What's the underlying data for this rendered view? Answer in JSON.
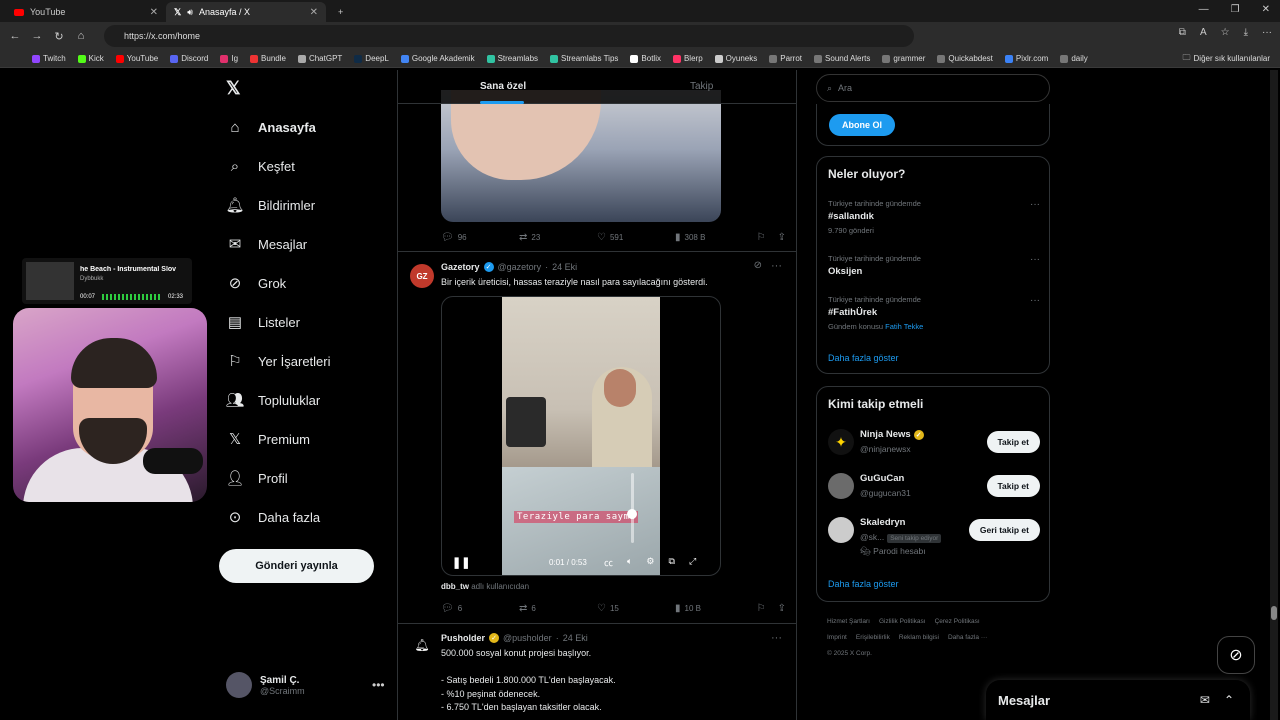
{
  "browser": {
    "tabs": [
      {
        "label": "YouTube"
      },
      {
        "label": "Anasayfa / X"
      }
    ],
    "url": "https://x.com/home",
    "bookmarks": [
      "Twitch",
      "Kick",
      "YouTube",
      "Discord",
      "Ig",
      "Bundle",
      "ChatGPT",
      "DeepL",
      "Google Akademik",
      "Streamlabs",
      "Streamlabs Tips",
      "Botlix",
      "Blerp",
      "Oyuneks",
      "Parrot",
      "Sound Alerts",
      "grammer",
      "Quickabdest",
      "Pixlr.com",
      "daily"
    ],
    "other_bookmarks": "Diğer sık kullanılanlar"
  },
  "nav": {
    "items": [
      {
        "label": "Anasayfa",
        "icon": "home-icon"
      },
      {
        "label": "Keşfet",
        "icon": "search-icon"
      },
      {
        "label": "Bildirimler",
        "icon": "bell-icon"
      },
      {
        "label": "Mesajlar",
        "icon": "mail-icon"
      },
      {
        "label": "Grok",
        "icon": "grok-icon"
      },
      {
        "label": "Listeler",
        "icon": "list-icon"
      },
      {
        "label": "Yer İşaretleri",
        "icon": "bookmark-icon"
      },
      {
        "label": "Topluluklar",
        "icon": "communities-icon"
      },
      {
        "label": "Premium",
        "icon": "x-icon"
      },
      {
        "label": "Profil",
        "icon": "profile-icon"
      },
      {
        "label": "Daha fazla",
        "icon": "more-circle-icon"
      }
    ],
    "post_button": "Gönderi yayınla",
    "profile_name": "Şamil Ç.",
    "profile_handle": "@Scraimm"
  },
  "music_overlay": {
    "title": "he Beach - Instrumental Slov",
    "artist": "Dybbukk",
    "elapsed": "00:07",
    "total": "02:33"
  },
  "feed": {
    "tab_foryou": "Sana özel",
    "tab_following": "Takip",
    "tweet1_stats": {
      "replies": "96",
      "retweets": "23",
      "likes": "591",
      "views": "308 B"
    },
    "tweet2": {
      "name": "Gazetory",
      "handle": "@gazetory",
      "date": "24 Eki",
      "text": "Bir içerik üreticisi, hassas teraziyle nasıl para sayılacağını gösterdi.",
      "video_caption": "Teraziyle para sayma",
      "video_time": "0:01 / 0:53",
      "video_progress": 0.02,
      "volume_level": 0.5,
      "credit_user": "dbb_tw",
      "credit_suffix": "adlı kullanıcıdan",
      "replies": "6",
      "retweets": "6",
      "likes": "15",
      "views": "10 B"
    },
    "tweet3": {
      "name": "Pusholder",
      "handle": "@pusholder",
      "date": "24 Eki",
      "line1": "500.000 sosyal konut projesi başlıyor.",
      "line2": "- Satış bedeli 1.800.000 TL'den başlayacak.",
      "line3": "- %10 peşinat ödenecek.",
      "line4": "- 6.750 TL'den başlayan taksitler olacak."
    }
  },
  "right": {
    "search_placeholder": "Ara",
    "subscribe": "Abone Ol",
    "trends_title": "Neler oluyor?",
    "trends": [
      {
        "context": "Türkiye tarihinde gündemde",
        "tag": "#sallandık",
        "count": "9.790 gönderi"
      },
      {
        "context": "Türkiye tarihinde gündemde",
        "tag": "Oksijen",
        "count": ""
      },
      {
        "context": "Türkiye tarihinde gündemde",
        "tag": "#FatihÜrek",
        "count": "Gündem konusu",
        "link": "Fatih Tekke"
      }
    ],
    "show_more": "Daha fazla göster",
    "who_title": "Kimi takip etmeli",
    "who": [
      {
        "name": "Ninja News",
        "handle": "@ninjanewsx",
        "button": "Takip et"
      },
      {
        "name": "GuGuCan",
        "handle": "@gugucan31",
        "button": "Takip et"
      },
      {
        "name": "Skaledryn",
        "handle": "@sk...",
        "follows_you": "Seni takip ediyor",
        "parody": "Parodi hesabı",
        "button": "Geri takip et"
      }
    ],
    "show_more2": "Daha fazla göster",
    "footer": [
      "Hizmet Şartları",
      "Gizlilik Politikası",
      "Çerez Politikası",
      "Imprint",
      "Erişilebilirlik",
      "Reklam bilgisi",
      "Daha fazla ···",
      "© 2025 X Corp."
    ]
  },
  "messages_drawer": "Mesajlar"
}
